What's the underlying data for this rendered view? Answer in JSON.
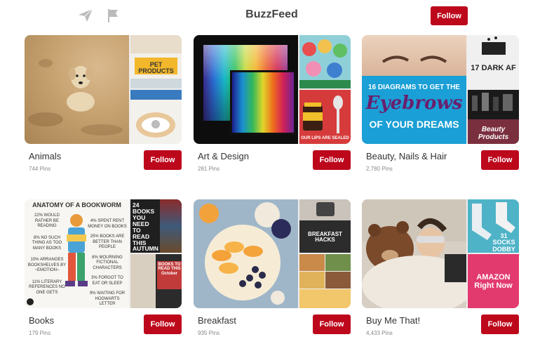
{
  "header": {
    "title": "BuzzFeed",
    "follow_label": "Follow",
    "icons": [
      "send-icon",
      "flag-icon"
    ]
  },
  "boards": [
    {
      "name": "Animals",
      "pins": "744 Pins",
      "follow_label": "Follow",
      "tiles": {
        "tr_text": "PET PRODUCTS",
        "br_text": ""
      }
    },
    {
      "name": "Art & Design",
      "pins": "281 Pins",
      "follow_label": "Follow",
      "tiles": {
        "br_text": "OUR LIPS ARE SEALED"
      }
    },
    {
      "name": "Beauty, Nails & Hair",
      "pins": "2,780 Pins",
      "follow_label": "Follow",
      "tiles": {
        "big_line1": "16 DIAGRAMS TO GET THE",
        "big_line2": "Eyebrows",
        "big_line3": "OF YOUR DREAMS",
        "tr_text": "17 DARK AF",
        "br_text": "Beauty Products"
      }
    },
    {
      "name": "Books",
      "pins": "179 Pins",
      "follow_label": "Follow",
      "tiles": {
        "big_title": "ANATOMY OF A BOOKWORM",
        "big_notes_left": [
          "22% WOULD RATHER BE READING",
          "8% NO SUCH THING AS TOO MANY BOOKS",
          "10% ARRANGES BOOKSHELVES BY ~EMOTION~",
          "11% LITERARY REFERENCES NO ONE GETS"
        ],
        "big_notes_right": [
          "4% SPENT RENT MONEY ON BOOKS",
          "25% BOOKS ARE BETTER THAN PEOPLE",
          "8% MOURNING FICTIONAL CHARACTERS",
          "3% FORGOT TO EAT OR SLEEP",
          "9% WAITING FOR HOGWARTS LETTER"
        ],
        "tr_text": "24 BOOKS YOU NEED TO READ THIS AUTUMN",
        "br_text": "BOOKS TO READ THIS October"
      }
    },
    {
      "name": "Breakfast",
      "pins": "935 Pins",
      "follow_label": "Follow",
      "tiles": {
        "tr_text": "BREAKFAST HACKS"
      }
    },
    {
      "name": "Buy Me That!",
      "pins": "4,433 Pins",
      "follow_label": "Follow",
      "tiles": {
        "tr_text": "31 SOCKS DOBBY",
        "br_text": "AMAZON Right Now"
      }
    }
  ],
  "colors": {
    "follow_red": "#bd081c",
    "brow_blue": "#1a9fd6"
  }
}
